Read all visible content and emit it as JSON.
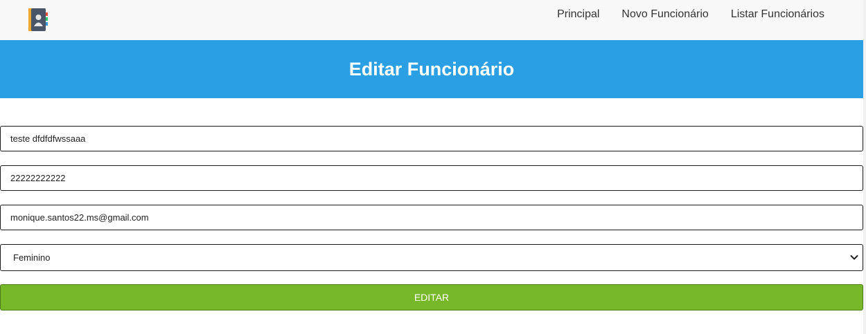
{
  "nav": {
    "logo_icon": "address-book-icon",
    "links": [
      "Principal",
      "Novo Funcionário",
      "Listar Funcionários"
    ]
  },
  "header": {
    "title": "Editar Funcionário",
    "background": "#2a9fe3"
  },
  "form": {
    "name_value": "teste dfdfdfwssaaa",
    "phone_value": "22222222222",
    "email_value": "monique.santos22.ms@gmail.com",
    "gender_selected": "Feminino",
    "submit_label": "EDITAR",
    "submit_color": "#77b82a"
  }
}
